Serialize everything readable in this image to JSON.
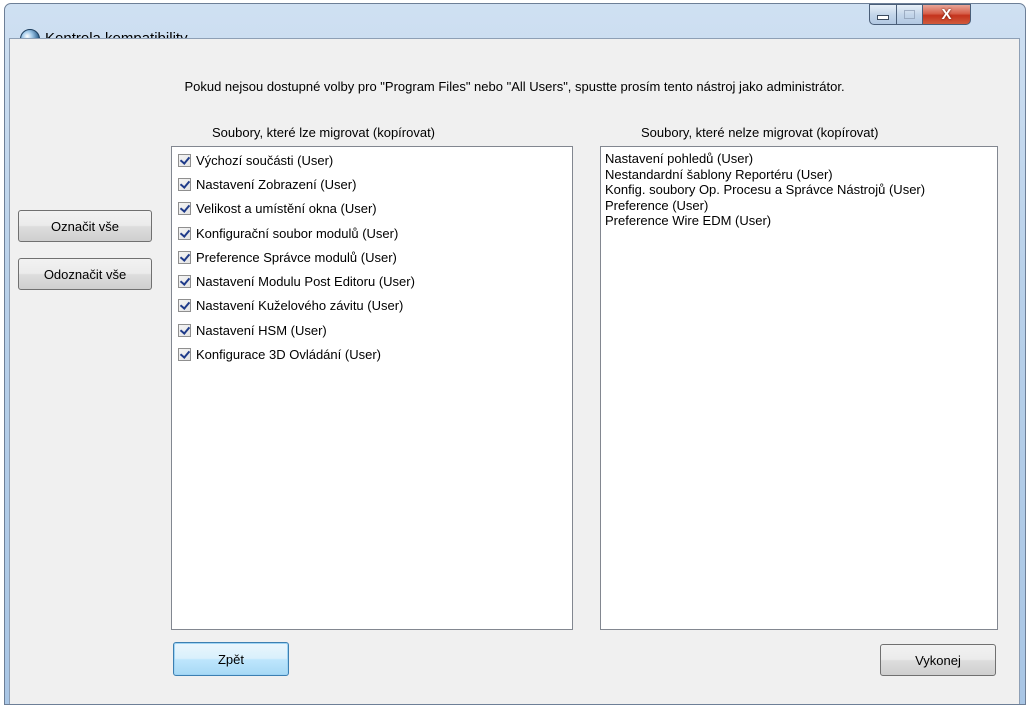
{
  "window": {
    "title": "Kontrola kompatibility",
    "icon": "app-globe-icon",
    "controls": {
      "minimize": "minimize-icon",
      "maximize": "maximize-icon",
      "close": "X"
    }
  },
  "notice": "Pokud nejsou dostupné volby pro \"Program Files\" nebo \"All Users\", spustte prosím tento nástroj jako administrátor.",
  "left_buttons": {
    "select_all": "Označit vše",
    "deselect_all": "Odoznačit vše"
  },
  "migratable": {
    "header": "Soubory, které lze migrovat (kopírovat)",
    "items": [
      {
        "label": "Výchozí součásti (User)",
        "checked": true
      },
      {
        "label": "Nastavení Zobrazení (User)",
        "checked": true
      },
      {
        "label": "Velikost a umístění okna (User)",
        "checked": true
      },
      {
        "label": "Konfigurační soubor modulů (User)",
        "checked": true
      },
      {
        "label": "Preference Správce modulů (User)",
        "checked": true
      },
      {
        "label": "Nastavení Modulu Post Editoru (User)",
        "checked": true
      },
      {
        "label": "Nastavení Kuželového závitu (User)",
        "checked": true
      },
      {
        "label": "Nastavení HSM (User)",
        "checked": true
      },
      {
        "label": "Konfigurace 3D Ovládání (User)",
        "checked": true
      }
    ]
  },
  "non_migratable": {
    "header": "Soubory, které nelze migrovat (kopírovat)",
    "items": [
      "Nastavení pohledů (User)",
      "Nestandardní šablony Reportéru (User)",
      "Konfig. soubory Op. Procesu a Správce Nástrojů (User)",
      "Preference (User)",
      "Preference Wire EDM (User)"
    ]
  },
  "bottom_buttons": {
    "back": "Zpět",
    "execute": "Vykonej"
  }
}
